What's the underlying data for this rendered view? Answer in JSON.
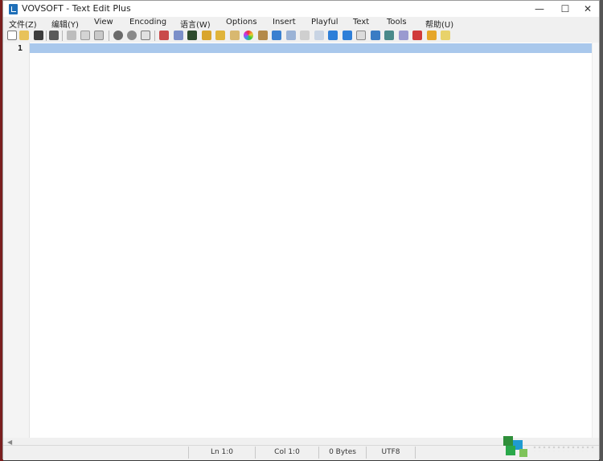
{
  "window": {
    "title": "VOVSOFT - Text Edit Plus"
  },
  "controls": {
    "minimize": "—",
    "maximize": "☐",
    "close": "✕"
  },
  "menu": [
    "文件(Z)",
    "编辑(Y)",
    "View",
    "Encoding",
    "语言(W)",
    "Options",
    "Insert",
    "Playful",
    "Text",
    "Tools",
    "帮助(U)"
  ],
  "toolbar_icons": [
    "new-file-icon",
    "open-folder-icon",
    "save-icon",
    "print-icon",
    "cut-icon",
    "copy-icon",
    "paste-icon",
    "find-icon",
    "replace-icon",
    "goto-icon",
    "bookmark-icon",
    "stack-icon",
    "image-icon",
    "lock-icon",
    "unlock-icon",
    "tag-icon",
    "color-wheel-icon",
    "pen-icon",
    "filter-icon",
    "email-icon",
    "list-icon",
    "envelope-icon",
    "arrow-right-icon",
    "arrow-down-icon",
    "document-icon",
    "text-up-icon",
    "text-down-icon",
    "grid-icon",
    "calendar-icon",
    "bell-icon",
    "note-icon"
  ],
  "editor": {
    "line_number": "1"
  },
  "status": {
    "ln": "Ln 1:0",
    "col": "Col 1:0",
    "bytes": "0 Bytes",
    "encoding": "UTF8"
  },
  "colors": {
    "current_line": "#a9c8ec",
    "editor_bg": "#ffffff",
    "chrome_bg": "#f0f0f0"
  }
}
